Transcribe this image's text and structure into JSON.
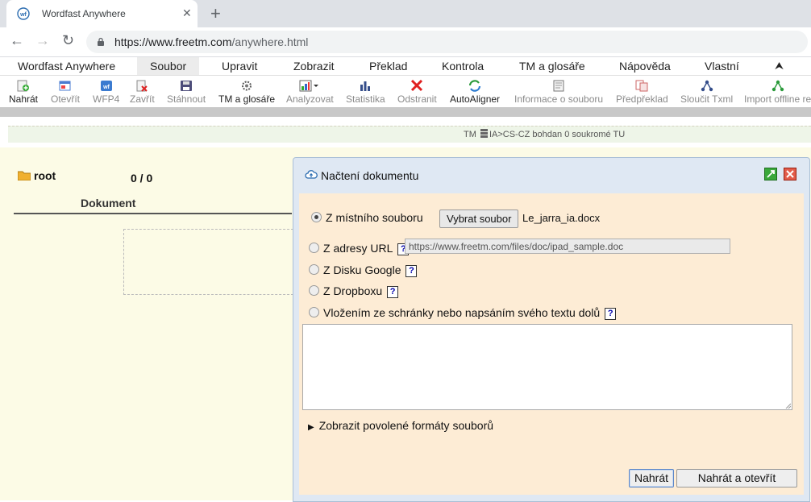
{
  "browser": {
    "tab_title": "Wordfast Anywhere",
    "close_glyph": "✕",
    "newtab_glyph": "+",
    "back_glyph": "←",
    "forward_glyph": "→",
    "reload_glyph": "↻",
    "url_host": "https://www.freetm.com",
    "url_path": "/anywhere.html"
  },
  "menu": {
    "items": [
      "Wordfast Anywhere",
      "Soubor",
      "Upravit",
      "Zobrazit",
      "Překlad",
      "Kontrola",
      "TM a glosáře",
      "Nápověda",
      "Vlastní"
    ],
    "collapse_glyph": "⮝"
  },
  "toolbar": {
    "items": [
      "Nahrát",
      "Otevřít",
      "WFP4",
      "Zavřít",
      "Stáhnout",
      "TM a glosáře",
      "Analyzovat",
      "Statistika",
      "Odstranit",
      "AutoAligner",
      "Informace o souboru",
      "Předpřeklad",
      "Sloučit Txml",
      "Import offline re"
    ]
  },
  "status": {
    "pre": "TM",
    "text": "IA>CS-CZ bohdan 0 soukromé TU"
  },
  "main": {
    "root_label": "root",
    "count": "0 / 0",
    "column_header": "Dokument"
  },
  "dialog": {
    "title": "Načtení dokumentu",
    "options": {
      "local": "Z místního souboru",
      "url": "Z adresy URL",
      "google": "Z Disku Google",
      "dropbox": "Z Dropboxu",
      "paste": "Vložením ze schránky nebo napsáním svého textu dolů"
    },
    "help_glyph": "?",
    "choose_file_button": "Vybrat soubor",
    "chosen_file": "Le_jarra_ia.docx",
    "url_value": "https://www.freetm.com/files/doc/ipad_sample.doc",
    "show_formats": "Zobrazit povolené formáty souborů",
    "formats_glyph": "▶",
    "upload_button": "Nahrát",
    "upload_open_button": "Nahrát a otevřít"
  },
  "colors": {
    "dialog_body": "#fdecd5",
    "main_bg": "#fcfbe6",
    "dialog_frame": "#dfe8f3"
  }
}
